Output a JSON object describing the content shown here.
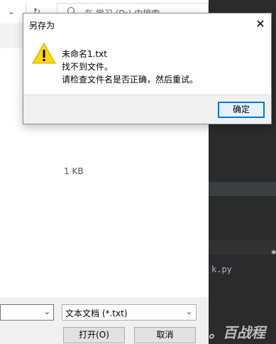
{
  "background_window": {
    "search_placeholder": "在 学习 (D:) 中搜索",
    "file_size": "1 KB",
    "file_type": "文本文档 (*.txt)",
    "open_button": "打开(O)",
    "cancel_button": "取消"
  },
  "editor": {
    "code_snippet": "k.py"
  },
  "watermark": "。百战程",
  "dialog": {
    "title": "另存为",
    "filename": "未命名1.txt",
    "message": "找不到文件。",
    "hint": "请检查文件名是否正确，然后重试。",
    "ok_button": "确定"
  },
  "colors": {
    "ok_border": "#0078d7",
    "warning_yellow": "#ffd800",
    "editor_bg": "#2b2b2b"
  }
}
